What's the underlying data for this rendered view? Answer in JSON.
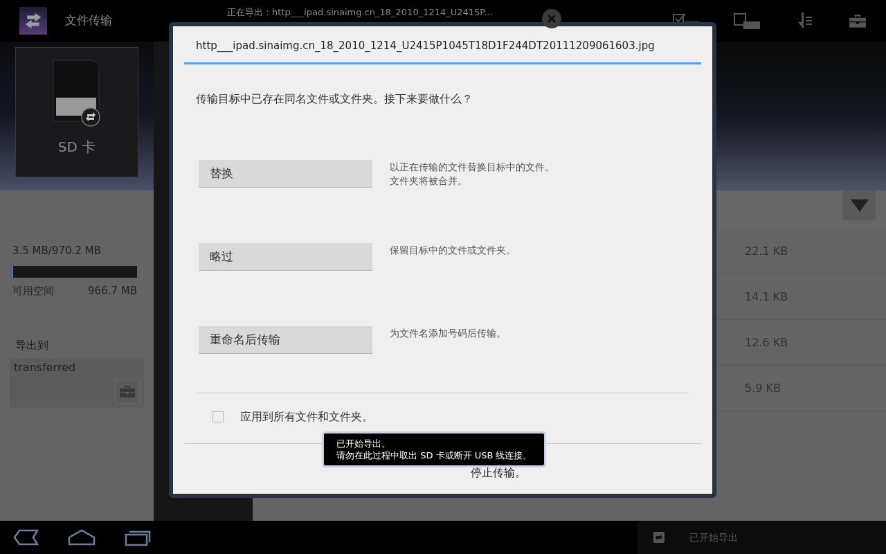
{
  "top_bar": {
    "title": "文件传输",
    "status": "正在导出：http___ipad.sinaimg.cn_18_2010_1214_U2415P..."
  },
  "sidebar": {
    "device_label": "SD 卡",
    "usage": "3.5 MB/970.2 MB",
    "level": 0.004,
    "free_label": "可用空间",
    "free_value": "966.7 MB",
    "export_label": "导出到",
    "export_folder": "transferred"
  },
  "file_sizes": [
    "22.1 KB",
    "14.1 KB",
    "12.6 KB",
    "5.9 KB"
  ],
  "dialog": {
    "title": "http___ipad.sinaimg.cn_18_2010_1214_U2415P1045T18D1F244DT20111209061603.jpg",
    "message": "传输目标中已存在同名文件或文件夹。接下来要做什么？",
    "options": [
      {
        "label": "替换",
        "description": [
          "以正在传输的文件替换目标中的文件。",
          "文件夹将被合并。"
        ]
      },
      {
        "label": "略过",
        "description": [
          "保留目标中的文件或文件夹。"
        ]
      },
      {
        "label": "重命名后传输",
        "description": [
          "为文件名添加号码后传输。"
        ]
      }
    ],
    "apply_all": {
      "label": "应用到所有文件和文件夹。",
      "checked": false
    },
    "stop_button": "停止传输。"
  },
  "toast": {
    "lines": [
      "已开始导出。",
      "请勿在此过程中取出 SD 卡或断开 USB 线连接。"
    ]
  },
  "nav_bar": {
    "notification": "已开始导出"
  }
}
